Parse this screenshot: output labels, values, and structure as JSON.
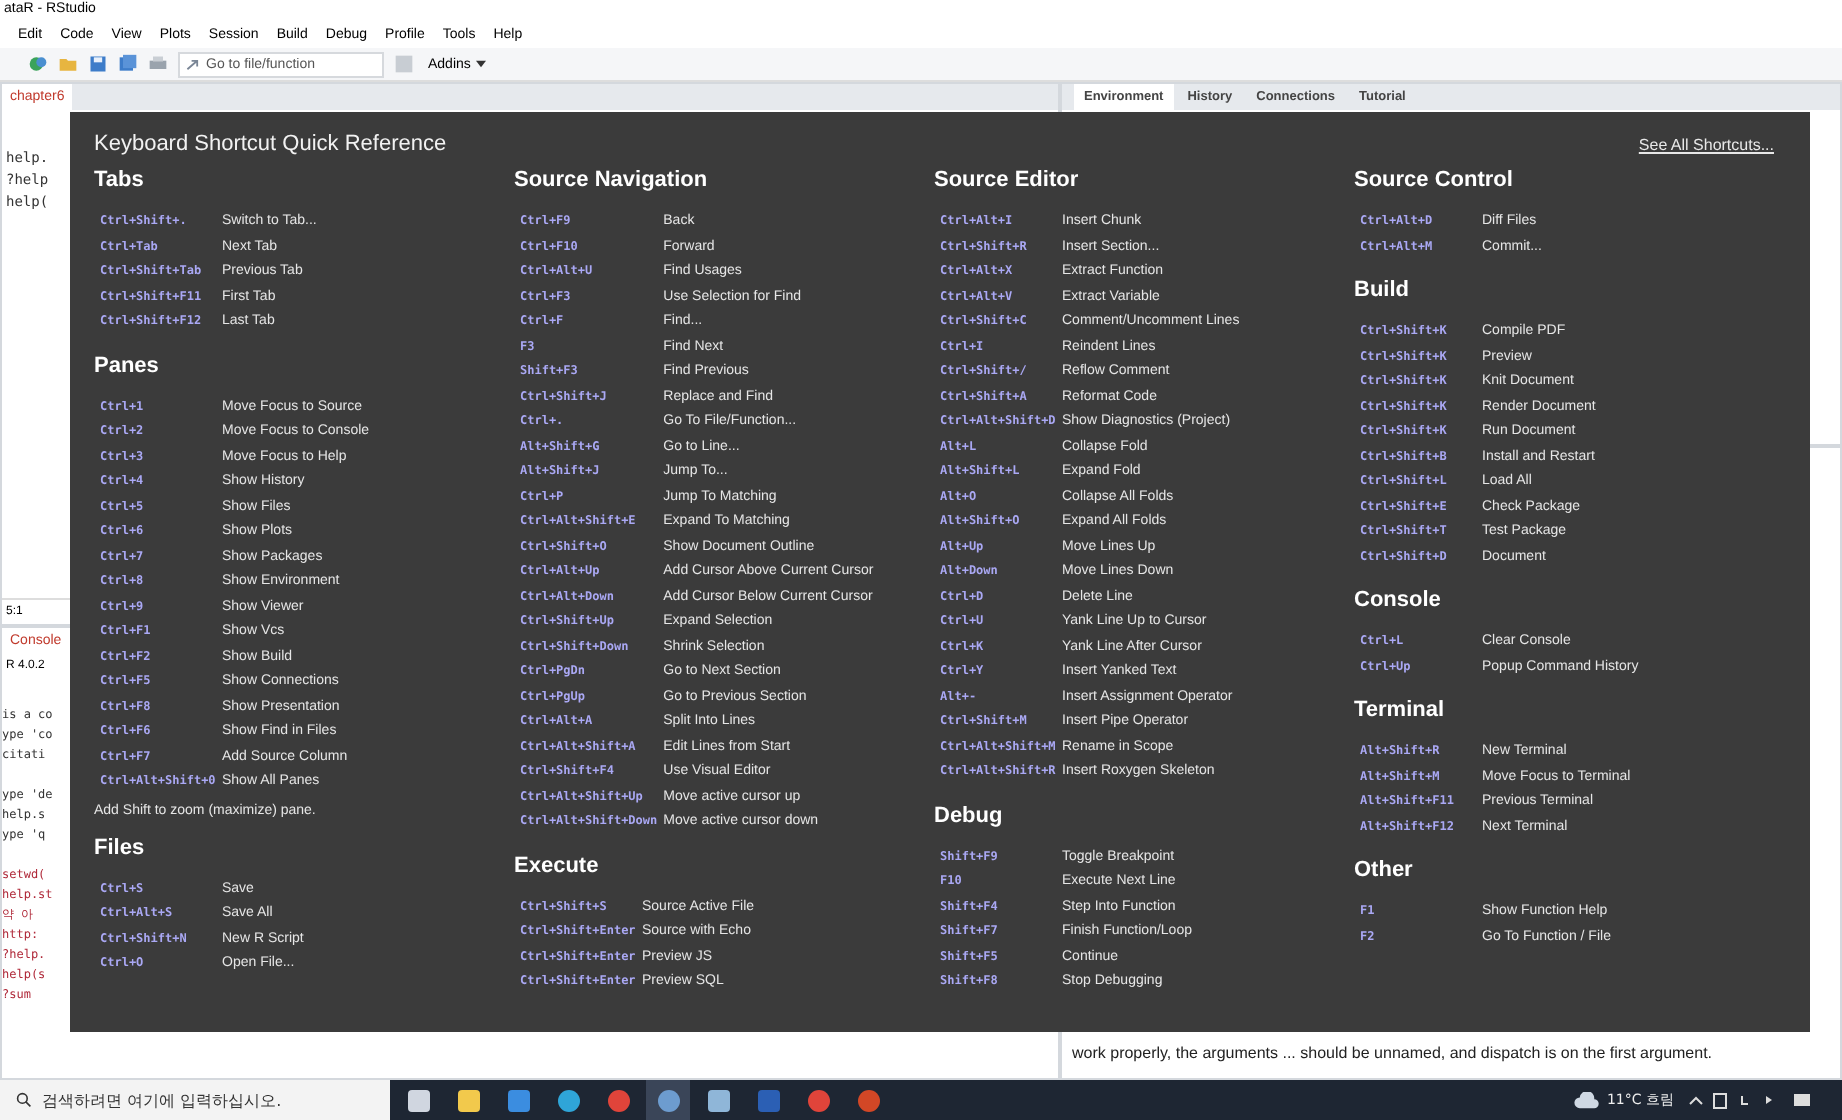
{
  "window": {
    "title": "ataR - RStudio"
  },
  "menu": [
    "Edit",
    "Code",
    "View",
    "Plots",
    "Session",
    "Build",
    "Debug",
    "Profile",
    "Tools",
    "Help"
  ],
  "toolbar": {
    "goto_placeholder": "Go to file/function",
    "addins": "Addins"
  },
  "source_tabs": [
    {
      "label": "chapter6",
      "selected": true
    }
  ],
  "editor_lines": [
    "help.",
    "?help",
    "help("
  ],
  "cursor_position": "5:1",
  "console_tabs": [
    {
      "label": "Console",
      "selected": true
    }
  ],
  "console_version": "R 4.0.2",
  "console_lines": [
    "is a co",
    "ype 'co",
    "citati",
    "ype 'de",
    "help.s",
    "ype 'q",
    "setwd(",
    "help.st",
    "약 아",
    "http:",
    "?help.",
    "help(s",
    "?sum"
  ],
  "right_tabs": [
    {
      "label": "Environment",
      "selected": true
    },
    {
      "label": "History",
      "selected": false
    },
    {
      "label": "Connections",
      "selected": false
    },
    {
      "label": "Tutorial",
      "selected": false
    }
  ],
  "help_text": "work properly, the arguments ... should be unnamed, and dispatch is on the first argument.",
  "overlay": {
    "title": "Keyboard Shortcut Quick Reference",
    "link": "See All Shortcuts...",
    "columns": [
      {
        "sections": [
          {
            "heading": "Tabs",
            "rows": [
              {
                "key": "Ctrl+Shift+.",
                "action": "Switch to Tab..."
              },
              {
                "key": "Ctrl+Tab",
                "action": "Next Tab"
              },
              {
                "key": "Ctrl+Shift+Tab",
                "action": "Previous Tab"
              },
              {
                "key": "Ctrl+Shift+F11",
                "action": "First Tab"
              },
              {
                "key": "Ctrl+Shift+F12",
                "action": "Last Tab"
              }
            ]
          },
          {
            "heading": "Panes",
            "rows": [
              {
                "key": "Ctrl+1",
                "action": "Move Focus to Source"
              },
              {
                "key": "Ctrl+2",
                "action": "Move Focus to Console"
              },
              {
                "key": "Ctrl+3",
                "action": "Move Focus to Help"
              },
              {
                "key": "Ctrl+4",
                "action": "Show History"
              },
              {
                "key": "Ctrl+5",
                "action": "Show Files"
              },
              {
                "key": "Ctrl+6",
                "action": "Show Plots"
              },
              {
                "key": "Ctrl+7",
                "action": "Show Packages"
              },
              {
                "key": "Ctrl+8",
                "action": "Show Environment"
              },
              {
                "key": "Ctrl+9",
                "action": "Show Viewer"
              },
              {
                "key": "Ctrl+F1",
                "action": "Show Vcs"
              },
              {
                "key": "Ctrl+F2",
                "action": "Show Build"
              },
              {
                "key": "Ctrl+F5",
                "action": "Show Connections"
              },
              {
                "key": "Ctrl+F8",
                "action": "Show Presentation"
              },
              {
                "key": "Ctrl+F6",
                "action": "Show Find in Files"
              },
              {
                "key": "Ctrl+F7",
                "action": "Add Source Column"
              },
              {
                "key": "Ctrl+Alt+Shift+0",
                "action": "Show All Panes"
              }
            ],
            "note": "Add Shift to zoom (maximize) pane."
          },
          {
            "heading": "Files",
            "rows": [
              {
                "key": "Ctrl+S",
                "action": "Save"
              },
              {
                "key": "Ctrl+Alt+S",
                "action": "Save All"
              },
              {
                "key": "Ctrl+Shift+N",
                "action": "New R Script"
              },
              {
                "key": "Ctrl+O",
                "action": "Open File..."
              }
            ]
          }
        ]
      },
      {
        "sections": [
          {
            "heading": "Source Navigation",
            "rows": [
              {
                "key": "Ctrl+F9",
                "action": "Back"
              },
              {
                "key": "Ctrl+F10",
                "action": "Forward"
              },
              {
                "key": "Ctrl+Alt+U",
                "action": "Find Usages"
              },
              {
                "key": "Ctrl+F3",
                "action": "Use Selection for Find"
              },
              {
                "key": "Ctrl+F",
                "action": "Find..."
              },
              {
                "key": "F3",
                "action": "Find Next"
              },
              {
                "key": "Shift+F3",
                "action": "Find Previous"
              },
              {
                "key": "Ctrl+Shift+J",
                "action": "Replace and Find"
              },
              {
                "key": "Ctrl+.",
                "action": "Go To File/Function..."
              },
              {
                "key": "Alt+Shift+G",
                "action": "Go to Line..."
              },
              {
                "key": "Alt+Shift+J",
                "action": "Jump To..."
              },
              {
                "key": "Ctrl+P",
                "action": "Jump To Matching"
              },
              {
                "key": "Ctrl+Alt+Shift+E",
                "action": "Expand To Matching"
              },
              {
                "key": "Ctrl+Shift+O",
                "action": "Show Document Outline"
              },
              {
                "key": "Ctrl+Alt+Up",
                "action": "Add Cursor Above Current Cursor"
              },
              {
                "key": "Ctrl+Alt+Down",
                "action": "Add Cursor Below Current Cursor"
              },
              {
                "key": "Ctrl+Shift+Up",
                "action": "Expand Selection"
              },
              {
                "key": "Ctrl+Shift+Down",
                "action": "Shrink Selection"
              },
              {
                "key": "Ctrl+PgDn",
                "action": "Go to Next Section"
              },
              {
                "key": "Ctrl+PgUp",
                "action": "Go to Previous Section"
              },
              {
                "key": "Ctrl+Alt+A",
                "action": "Split Into Lines"
              },
              {
                "key": "Ctrl+Alt+Shift+A",
                "action": "Edit Lines from Start"
              },
              {
                "key": "Ctrl+Shift+F4",
                "action": "Use Visual Editor"
              },
              {
                "key": "Ctrl+Alt+Shift+Up",
                "action": "Move active cursor up"
              },
              {
                "key": "Ctrl+Alt+Shift+Down",
                "action": "Move active cursor down"
              }
            ]
          },
          {
            "heading": "Execute",
            "rows": [
              {
                "key": "Ctrl+Shift+S",
                "action": "Source Active File"
              },
              {
                "key": "Ctrl+Shift+Enter",
                "action": "Source with Echo"
              },
              {
                "key": "Ctrl+Shift+Enter",
                "action": "Preview JS"
              },
              {
                "key": "Ctrl+Shift+Enter",
                "action": "Preview SQL"
              }
            ]
          }
        ]
      },
      {
        "sections": [
          {
            "heading": "Source Editor",
            "rows": [
              {
                "key": "Ctrl+Alt+I",
                "action": "Insert Chunk"
              },
              {
                "key": "Ctrl+Shift+R",
                "action": "Insert Section..."
              },
              {
                "key": "Ctrl+Alt+X",
                "action": "Extract Function"
              },
              {
                "key": "Ctrl+Alt+V",
                "action": "Extract Variable"
              },
              {
                "key": "Ctrl+Shift+C",
                "action": "Comment/Uncomment Lines"
              },
              {
                "key": "Ctrl+I",
                "action": "Reindent Lines"
              },
              {
                "key": "Ctrl+Shift+/",
                "action": "Reflow Comment"
              },
              {
                "key": "Ctrl+Shift+A",
                "action": "Reformat Code"
              },
              {
                "key": "Ctrl+Alt+Shift+D",
                "action": "Show Diagnostics (Project)"
              },
              {
                "key": "Alt+L",
                "action": "Collapse Fold"
              },
              {
                "key": "Alt+Shift+L",
                "action": "Expand Fold"
              },
              {
                "key": "Alt+O",
                "action": "Collapse All Folds"
              },
              {
                "key": "Alt+Shift+O",
                "action": "Expand All Folds"
              },
              {
                "key": "Alt+Up",
                "action": "Move Lines Up"
              },
              {
                "key": "Alt+Down",
                "action": "Move Lines Down"
              },
              {
                "key": "Ctrl+D",
                "action": "Delete Line"
              },
              {
                "key": "Ctrl+U",
                "action": "Yank Line Up to Cursor"
              },
              {
                "key": "Ctrl+K",
                "action": "Yank Line After Cursor"
              },
              {
                "key": "Ctrl+Y",
                "action": "Insert Yanked Text"
              },
              {
                "key": "Alt+-",
                "action": "Insert Assignment Operator"
              },
              {
                "key": "Ctrl+Shift+M",
                "action": "Insert Pipe Operator"
              },
              {
                "key": "Ctrl+Alt+Shift+M",
                "action": "Rename in Scope"
              },
              {
                "key": "Ctrl+Alt+Shift+R",
                "action": "Insert Roxygen Skeleton"
              }
            ]
          },
          {
            "heading": "Debug",
            "rows": [
              {
                "key": "Shift+F9",
                "action": "Toggle Breakpoint"
              },
              {
                "key": "F10",
                "action": "Execute Next Line"
              },
              {
                "key": "Shift+F4",
                "action": "Step Into Function"
              },
              {
                "key": "Shift+F7",
                "action": "Finish Function/Loop"
              },
              {
                "key": "Shift+F5",
                "action": "Continue"
              },
              {
                "key": "Shift+F8",
                "action": "Stop Debugging"
              }
            ]
          }
        ]
      },
      {
        "sections": [
          {
            "heading": "Source Control",
            "rows": [
              {
                "key": "Ctrl+Alt+D",
                "action": "Diff Files"
              },
              {
                "key": "Ctrl+Alt+M",
                "action": "Commit..."
              }
            ]
          },
          {
            "heading": "Build",
            "rows": [
              {
                "key": "Ctrl+Shift+K",
                "action": "Compile PDF"
              },
              {
                "key": "Ctrl+Shift+K",
                "action": "Preview"
              },
              {
                "key": "Ctrl+Shift+K",
                "action": "Knit Document"
              },
              {
                "key": "Ctrl+Shift+K",
                "action": "Render Document"
              },
              {
                "key": "Ctrl+Shift+K",
                "action": "Run Document"
              },
              {
                "key": "Ctrl+Shift+B",
                "action": "Install and Restart"
              },
              {
                "key": "Ctrl+Shift+L",
                "action": "Load All"
              },
              {
                "key": "Ctrl+Shift+E",
                "action": "Check Package"
              },
              {
                "key": "Ctrl+Shift+T",
                "action": "Test Package"
              },
              {
                "key": "Ctrl+Shift+D",
                "action": "Document"
              }
            ]
          },
          {
            "heading": "Console",
            "rows": [
              {
                "key": "Ctrl+L",
                "action": "Clear Console"
              },
              {
                "key": "Ctrl+Up",
                "action": "Popup Command History"
              }
            ]
          },
          {
            "heading": "Terminal",
            "rows": [
              {
                "key": "Alt+Shift+R",
                "action": "New Terminal"
              },
              {
                "key": "Alt+Shift+M",
                "action": "Move Focus to Terminal"
              },
              {
                "key": "Alt+Shift+F11",
                "action": "Previous Terminal"
              },
              {
                "key": "Alt+Shift+F12",
                "action": "Next Terminal"
              }
            ]
          },
          {
            "heading": "Other",
            "rows": [
              {
                "key": "F1",
                "action": "Show Function Help"
              },
              {
                "key": "F2",
                "action": "Go To Function / File"
              }
            ]
          }
        ]
      }
    ]
  },
  "taskbar": {
    "search_placeholder": "검색하려면 여기에 입력하십시오.",
    "apps": [
      {
        "kind": "taskview",
        "selected": false
      },
      {
        "kind": "folder",
        "selected": false
      },
      {
        "kind": "store",
        "selected": false
      },
      {
        "kind": "edge",
        "selected": false
      },
      {
        "kind": "chrome",
        "selected": false
      },
      {
        "kind": "rstudio",
        "selected": true
      },
      {
        "kind": "notepad",
        "selected": false
      },
      {
        "kind": "word",
        "selected": false
      },
      {
        "kind": "chrome",
        "selected": false
      },
      {
        "kind": "powerpoint",
        "selected": false
      }
    ],
    "weather": "11°C 흐림"
  }
}
